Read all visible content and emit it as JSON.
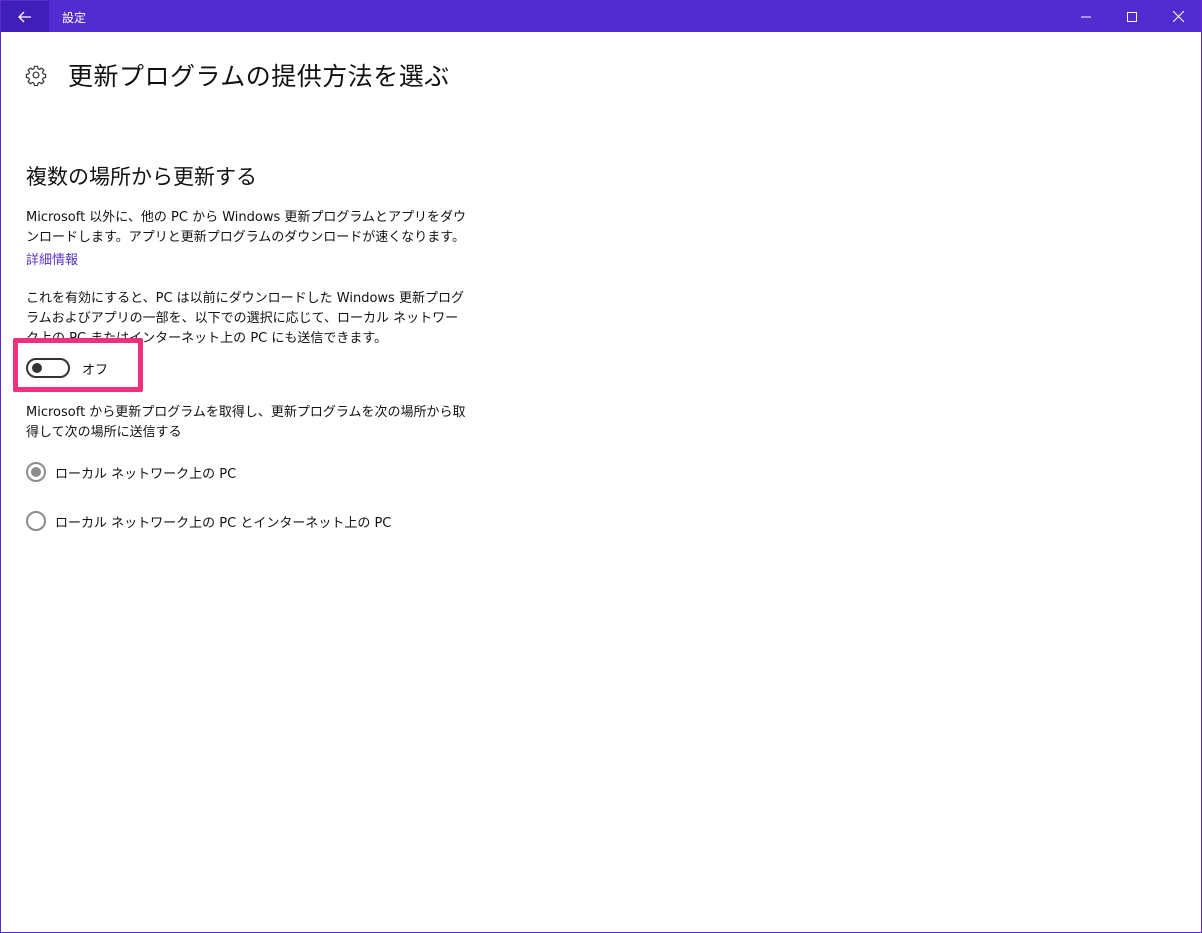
{
  "window": {
    "app_title": "設定",
    "accent": "#522bd1"
  },
  "header": {
    "title": "更新プログラムの提供方法を選ぶ",
    "icon": "gear-icon"
  },
  "section": {
    "title": "複数の場所から更新する",
    "description_1": "Microsoft 以外に、他の PC から Windows 更新プログラムとアプリをダウンロードします。アプリと更新プログラムのダウンロードが速くなります。",
    "details_link": "詳細情報",
    "description_2": "これを有効にすると、PC は以前にダウンロードした Windows 更新プログラムおよびアプリの一部を、以下での選択に応じて、ローカル ネットワーク上の PC またはインターネット上の PC にも送信できます。",
    "toggle": {
      "state": "off",
      "label": "オフ"
    },
    "description_3": "Microsoft から更新プログラムを取得し、更新プログラムを次の場所から取得して次の場所に送信する",
    "options": [
      {
        "label": "ローカル ネットワーク上の PC",
        "selected": true
      },
      {
        "label": "ローカル ネットワーク上の PC とインターネット上の PC",
        "selected": false
      }
    ]
  },
  "highlight_color": "#f0307a"
}
